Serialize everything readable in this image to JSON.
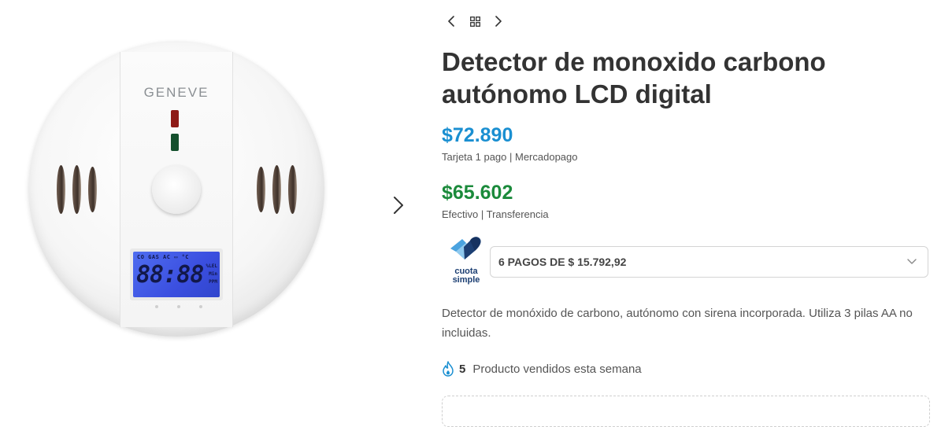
{
  "product": {
    "title": "Detector de monoxido carbono autónomo LCD digital",
    "image": {
      "brand": "GENEVE",
      "lcd_header": "CO  GAS  AC  ▭  °C",
      "lcd_digits": "88:88",
      "lcd_units": [
        "%LEL",
        "Min",
        "PPM"
      ]
    },
    "price_card": {
      "amount": "$72.890",
      "note": "Tarjeta 1 pago | Mercadopago",
      "color": "#1a8fd1"
    },
    "price_cash": {
      "amount": "$65.602",
      "note": "Efectivo | Transferencia",
      "color": "#1b8a3b"
    },
    "cuota_simple": {
      "logo_line1": "cuota",
      "logo_line2": "simple",
      "selected_option": "6 PAGOS DE $ 15.792,92"
    },
    "description": "Detector de monóxido de carbono, autónomo con sirena incorporada. Utiliza 3 pilas AA no incluidas.",
    "sold": {
      "count": "5",
      "label": "Producto vendidos esta semana"
    }
  },
  "icons": {
    "prev": "chevron-left-icon",
    "grid": "grid-icon",
    "next": "chevron-right-icon",
    "gallery_next": "chevron-right-icon",
    "dropdown": "chevron-down-icon",
    "fire": "fire-icon"
  }
}
